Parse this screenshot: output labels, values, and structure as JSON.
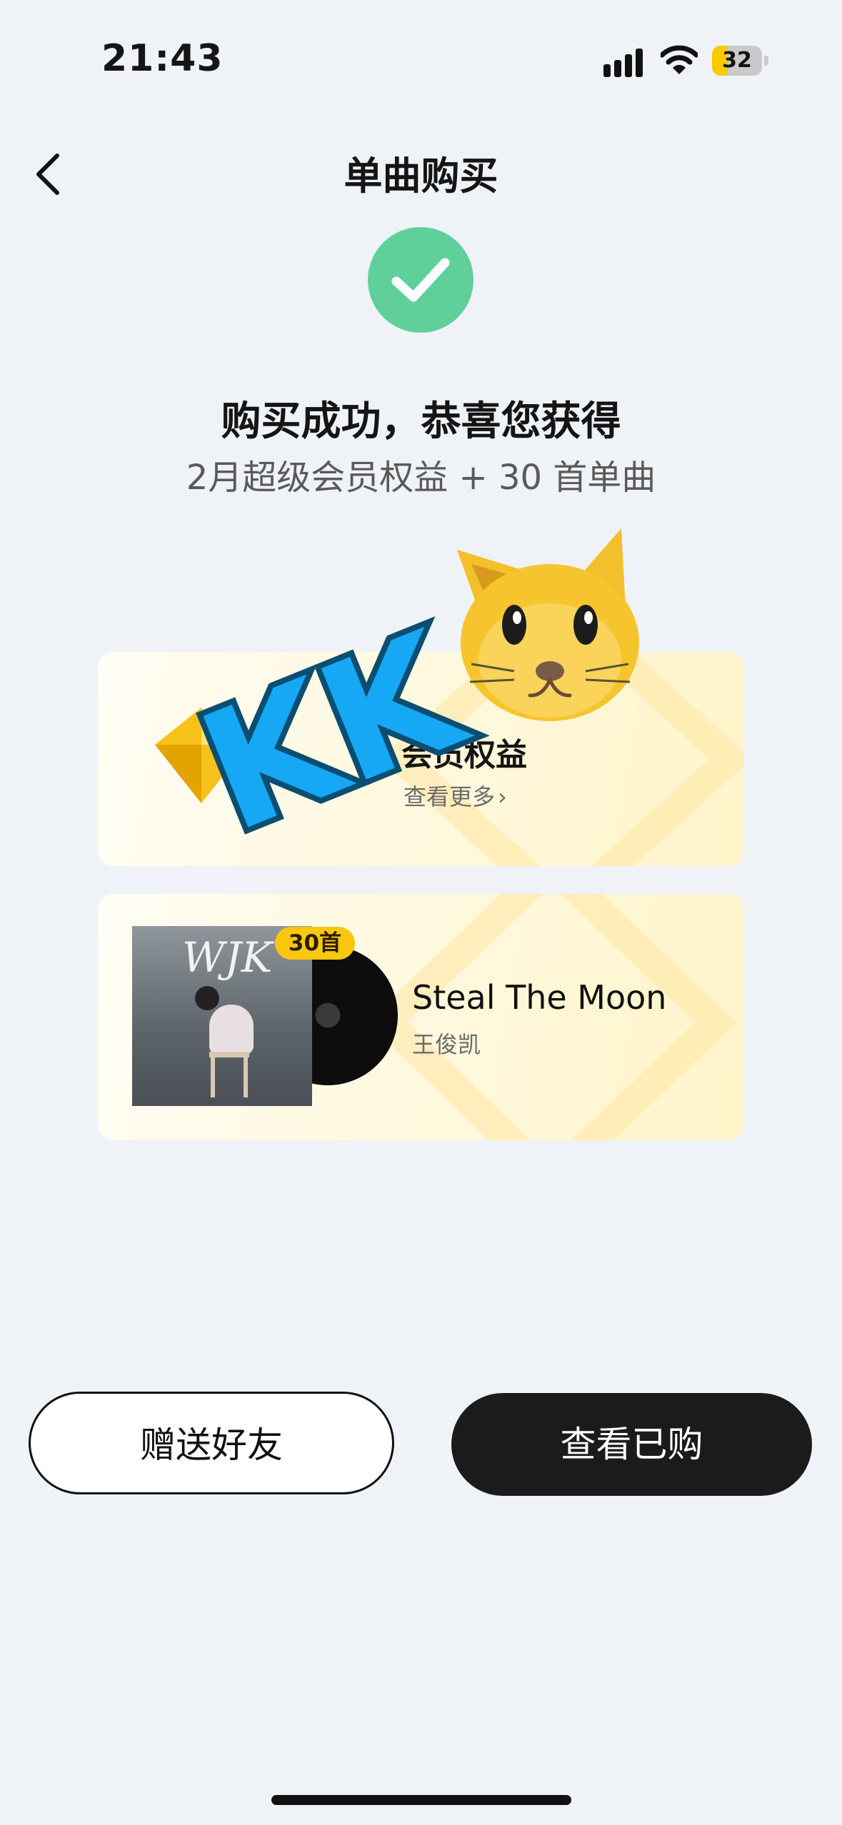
{
  "status_bar": {
    "time": "21:43",
    "battery": 32
  },
  "nav": {
    "title": "单曲购买"
  },
  "success": {
    "title": "购买成功，恭喜您获得",
    "subtitle": "2月超级会员权益 + 30 首单曲"
  },
  "benefit_card": {
    "title_visible": "会员权益",
    "link": "查看更多"
  },
  "song_card": {
    "badge": "30首",
    "title": "Steal The Moon",
    "artist": "王俊凯",
    "cover_lettering": "WJK"
  },
  "stickers": {
    "text_sticker": "KK",
    "emoji": "cat-face"
  },
  "buttons": {
    "gift": "赠送好友",
    "view": "查看已购"
  },
  "colors": {
    "background": "#eff3f7",
    "success_green": "#5fd09a",
    "badge_yellow": "#f9c80e",
    "primary_button": "#1b1b1b",
    "sticker_blue": "#17a8f5"
  }
}
